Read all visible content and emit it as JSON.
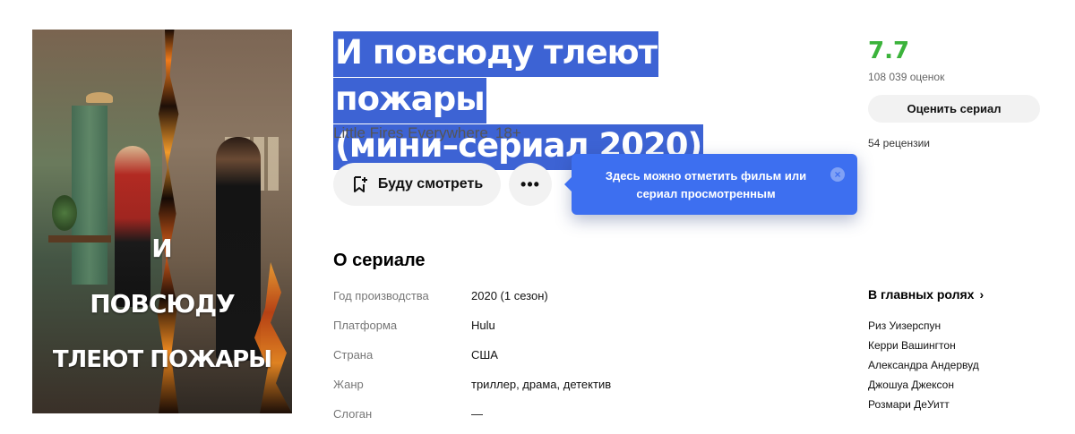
{
  "poster": {
    "title_line1": "И",
    "title_line2": "ПОВСЮДУ",
    "title_line3": "ТЛЕЮТ ПОЖАРЫ"
  },
  "header": {
    "title_line1": "И повсюду тлеют пожары",
    "title_line2": "(мини–сериал 2020)",
    "original_title": "Little Fires Everywhere",
    "age_rating": "18+"
  },
  "actions": {
    "watch_label": "Буду смотреть",
    "more_label": "•••"
  },
  "tooltip": {
    "text": "Здесь можно отметить фильм или сериал просмотренным",
    "close_label": "×"
  },
  "rating": {
    "value": "7.7",
    "votes": "108 039 оценок",
    "rate_label": "Оценить сериал",
    "reviews": "54 рецензии",
    "color": "#3bb33b"
  },
  "about": {
    "heading": "О сериале",
    "rows": [
      {
        "key": "Год производства",
        "value": "2020 (1 сезон)"
      },
      {
        "key": "Платформа",
        "value": "Hulu"
      },
      {
        "key": "Страна",
        "value": "США"
      },
      {
        "key": "Жанр",
        "value": "триллер, драма, детектив"
      },
      {
        "key": "Слоган",
        "value": "—"
      }
    ]
  },
  "cast": {
    "heading": "В главных ролях",
    "chevron": "›",
    "items": [
      "Риз Уизерспун",
      "Керри Вашингтон",
      "Александра Андервуд",
      "Джошуа Джексон",
      "Розмари ДеУитт"
    ]
  },
  "colors": {
    "highlight": "#3d63d4",
    "tooltip": "#3d6ff0",
    "button_bg": "#f2f2f2"
  }
}
